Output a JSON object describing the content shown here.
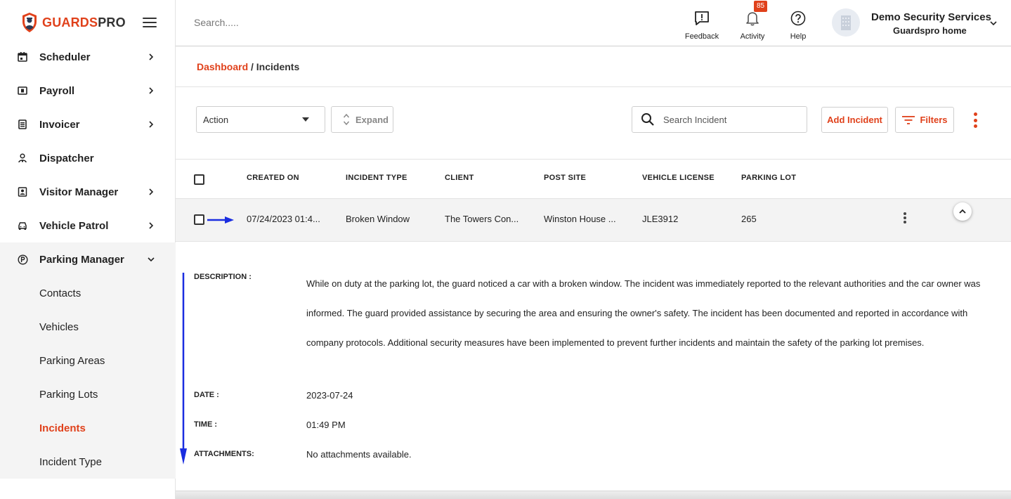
{
  "brand": {
    "name_part1": "GUARDS",
    "name_part2": "PRO",
    "accent_color": "#e0411b"
  },
  "sidebar": {
    "items": [
      {
        "label": "Scheduler",
        "icon": "calendar-icon",
        "has_chevron": true
      },
      {
        "label": "Payroll",
        "icon": "payroll-icon",
        "has_chevron": true
      },
      {
        "label": "Invoicer",
        "icon": "invoice-icon",
        "has_chevron": true
      },
      {
        "label": "Dispatcher",
        "icon": "dispatcher-icon",
        "has_chevron": false
      },
      {
        "label": "Visitor Manager",
        "icon": "visitor-icon",
        "has_chevron": true
      },
      {
        "label": "Vehicle Patrol",
        "icon": "car-icon",
        "has_chevron": true
      },
      {
        "label": "Parking Manager",
        "icon": "parking-icon",
        "expanded": true
      }
    ],
    "sub_items": [
      {
        "label": "Contacts"
      },
      {
        "label": "Vehicles"
      },
      {
        "label": "Parking Areas"
      },
      {
        "label": "Parking Lots"
      },
      {
        "label": "Incidents",
        "active": true
      },
      {
        "label": "Incident Type"
      }
    ]
  },
  "topbar": {
    "search_placeholder": "Search.....",
    "feedback_label": "Feedback",
    "activity_label": "Activity",
    "activity_badge": "85",
    "help_label": "Help",
    "user_name": "Demo Security Services",
    "user_sub": "Guardspro home"
  },
  "breadcrumb": {
    "root": "Dashboard",
    "separator": "/",
    "current": "Incidents"
  },
  "toolbar": {
    "action_label": "Action",
    "expand_label": "Expand",
    "search_placeholder": "Search Incident",
    "add_label": "Add Incident",
    "filters_label": "Filters"
  },
  "table": {
    "headers": [
      "CREATED ON",
      "INCIDENT TYPE",
      "CLIENT",
      "POST SITE",
      "VEHICLE LICENSE",
      "PARKING LOT"
    ],
    "rows": [
      {
        "created_on": "07/24/2023 01:4...",
        "incident_type": "Broken Window",
        "client": "The Towers Con...",
        "post_site": "Winston House ...",
        "vehicle_license": "JLE3912",
        "parking_lot": "265"
      }
    ]
  },
  "details": {
    "description_label": "DESCRIPTION :",
    "description": "While on duty at the parking lot, the guard noticed a car with a broken window. The incident was immediately reported to the relevant authorities and the car owner was informed. The guard provided assistance by securing the area and ensuring the owner's safety. The incident has been documented and reported in accordance with company protocols. Additional security measures have been implemented to prevent further incidents and maintain the safety of the parking lot premises.",
    "date_label": "DATE :",
    "date": "2023-07-24",
    "time_label": "TIME :",
    "time": "01:49 PM",
    "attachments_label": "ATTACHMENTS:",
    "attachments": "No attachments available."
  }
}
